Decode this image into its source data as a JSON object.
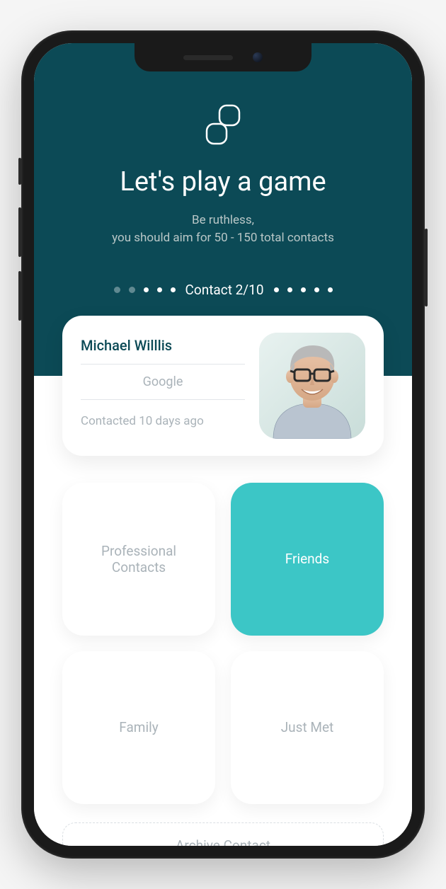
{
  "header": {
    "title": "Let's play a game",
    "subtitle_line1": "Be ruthless,",
    "subtitle_line2": "you should aim for 50 - 150 total contacts",
    "progress_label": "Contact 2/10"
  },
  "contact": {
    "name": "Michael Willlis",
    "company": "Google",
    "last_contact": "Contacted 10 days ago"
  },
  "categories": {
    "professional": "Professional Contacts",
    "friends": "Friends",
    "family": "Family",
    "just_met": "Just Met",
    "selected": "friends"
  },
  "archive_label": "Archive Contact",
  "colors": {
    "header_bg": "#0c4a56",
    "accent": "#3cc6c6",
    "muted": "#aab3b9"
  }
}
